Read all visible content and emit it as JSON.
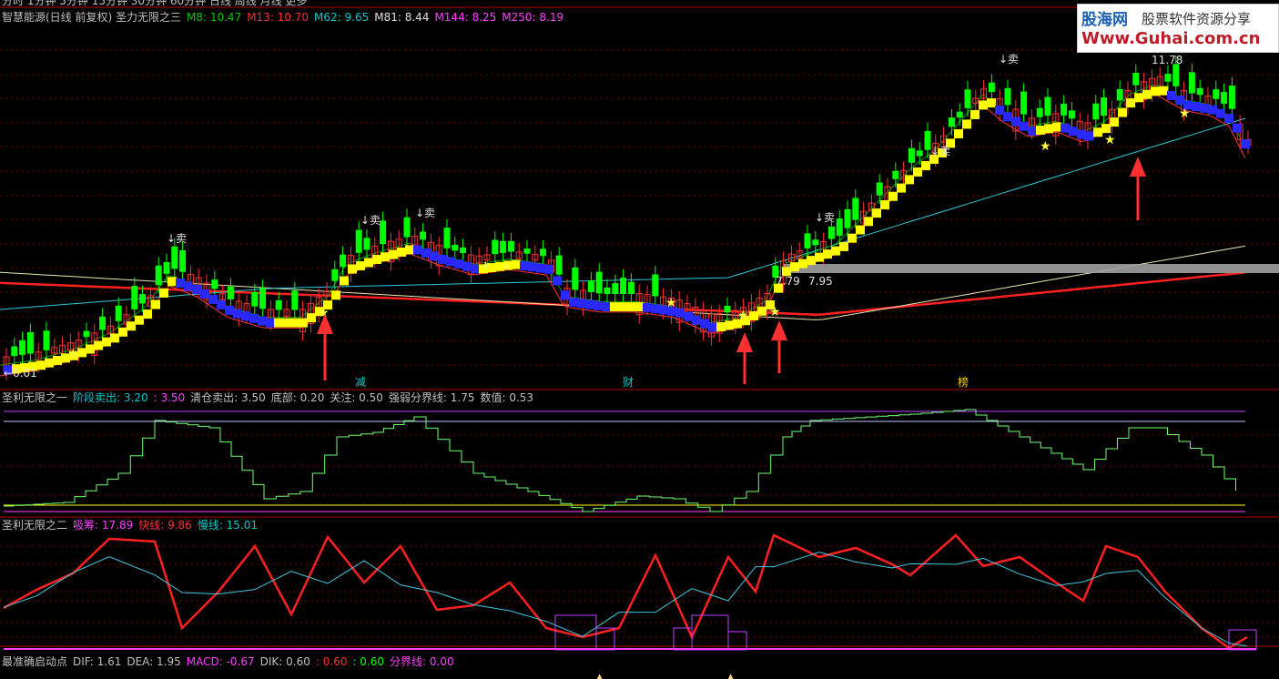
{
  "top_bar": {
    "clipped_text": "分时 1分钟 5分钟 15分钟 30分钟 60分钟 日线 周线 月线 更多"
  },
  "panel1": {
    "title": "智慧能源(日线 前复权) 圣力无限之三",
    "ma": [
      {
        "label": "M8: 10.47",
        "color": "#00c800"
      },
      {
        "label": "M13: 10.70",
        "color": "#ff3030"
      },
      {
        "label": "M62: 9.65",
        "color": "#00c8c8"
      },
      {
        "label": "M81: 8.44",
        "color": "#e0e0e0"
      },
      {
        "label": "M144: 8.25",
        "color": "#ff40ff"
      },
      {
        "label": "M250: 8.19",
        "color": "#ff40ff"
      }
    ],
    "labels": {
      "low": "6.01",
      "high": "11.78",
      "mid1": "7.79",
      "mid2": "7.95",
      "sell": "↓卖",
      "bottom_tags": [
        "减",
        "财",
        "榜"
      ]
    }
  },
  "panel2": {
    "title": "圣利无限之一",
    "items": [
      {
        "label": "阶段卖出: 3.20",
        "color": "#00c8c8"
      },
      {
        "label": ": 3.50",
        "color": "#ff40ff"
      },
      {
        "label": "清仓卖出: 3.50",
        "color": "#c0c0c0"
      },
      {
        "label": "底部: 0.20",
        "color": "#c0c0c0"
      },
      {
        "label": "关注: 0.50",
        "color": "#c0c0c0"
      },
      {
        "label": "强弱分界线: 1.75",
        "color": "#c0c0c0"
      },
      {
        "label": "数值: 0.53",
        "color": "#c0c0c0"
      }
    ]
  },
  "panel3": {
    "title": "圣利无限之二",
    "items": [
      {
        "label": "吸筹: 17.89",
        "color": "#ff40ff"
      },
      {
        "label": "快线: 9.86",
        "color": "#ff3030"
      },
      {
        "label": "慢线: 15.01",
        "color": "#00c8c8"
      }
    ]
  },
  "panel4": {
    "title": "最准确启动点",
    "items": [
      {
        "label": "DIF: 1.61",
        "color": "#c0c0c0"
      },
      {
        "label": "DEA: 1.95",
        "color": "#c0c0c0"
      },
      {
        "label": "MACD: -0.67",
        "color": "#ff40ff"
      },
      {
        "label": "DIK: 0.60",
        "color": "#c0c0c0"
      },
      {
        "label": ": 0.60",
        "color": "#ff3030"
      },
      {
        "label": ": 0.60",
        "color": "#00ff00"
      },
      {
        "label": "分界线: 0.00",
        "color": "#ff40ff"
      }
    ]
  },
  "watermark": {
    "brand": "股海网",
    "slogan": "股票软件资源分享",
    "url": "Www.Guhai.com.cn"
  },
  "colors": {
    "grid": "#7a0000",
    "separator": "#b00000",
    "up": "#ff3030",
    "down": "#00ff00",
    "stair_up": "#ffff00",
    "stair_down": "#2828ff",
    "arrow": "#ff3030",
    "star": "#ffff40"
  }
}
